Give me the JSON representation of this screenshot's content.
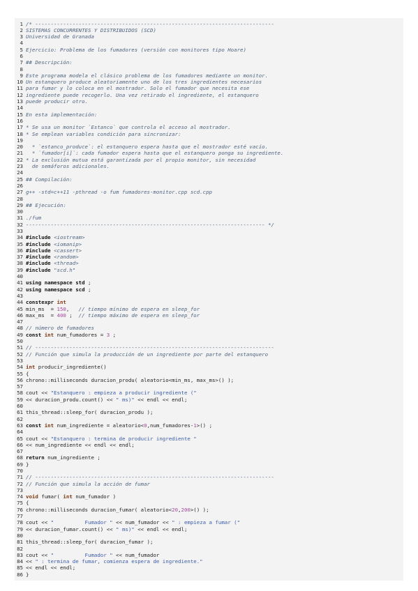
{
  "code": {
    "lines": [
      {
        "n": 1,
        "text": "/* -----------------------------------------------------------------------------"
      },
      {
        "n": 2,
        "text": "SISTEMAS CONCURRENTES Y DISTRIBUIDOS (SCD)"
      },
      {
        "n": 3,
        "text": "Universidad de Granada"
      },
      {
        "n": 4,
        "text": ""
      },
      {
        "n": 5,
        "text": "Ejercicio: Problema de los fumadores (versión con monitores tipo Hoare)"
      },
      {
        "n": 6,
        "text": ""
      },
      {
        "n": 7,
        "text": "## Descripción:"
      },
      {
        "n": 8,
        "text": ""
      },
      {
        "n": 9,
        "text": "Este programa modela el clásico problema de los fumadores mediante un monitor."
      },
      {
        "n": 10,
        "text": "Un estanquero produce aleatoriamente uno de los tres ingredientes necesarios"
      },
      {
        "n": 11,
        "text": "para fumar y lo coloca en el mostrador. Solo el fumador que necesita ese"
      },
      {
        "n": 12,
        "text": "ingrediente puede recogerlo. Una vez retirado el ingrediente, el estanquero"
      },
      {
        "n": 13,
        "text": "puede producir otro."
      },
      {
        "n": 14,
        "text": ""
      },
      {
        "n": 15,
        "text": "En esta implementación:"
      },
      {
        "n": 16,
        "text": ""
      },
      {
        "n": 17,
        "text": "* Se usa un monitor `Estanco` que controla el acceso al mostrador."
      },
      {
        "n": 18,
        "text": "* Se emplean variables condición para sincronizar:"
      },
      {
        "n": 19,
        "text": ""
      },
      {
        "n": 20,
        "text": "  * `estanco_produce`: el estanquero espera hasta que el mostrador esté vacío."
      },
      {
        "n": 21,
        "text": "  * `fumador[i]`: cada fumador espera hasta que el estanquero ponga su ingrediente."
      },
      {
        "n": 22,
        "text": "* La exclusión mutua está garantizada por el propio monitor, sin necesidad"
      },
      {
        "n": 23,
        "text": "  de semáforos adicionales."
      },
      {
        "n": 24,
        "text": ""
      },
      {
        "n": 25,
        "text": "## Compilación:"
      },
      {
        "n": 26,
        "text": ""
      },
      {
        "n": 27,
        "text": "g++ -std=c++11 -pthread -o fum fumadores-monitor.cpp scd.cpp"
      },
      {
        "n": 28,
        "text": ""
      },
      {
        "n": 29,
        "text": "## Ejecución:"
      },
      {
        "n": 30,
        "text": ""
      },
      {
        "n": 31,
        "text": "./fum"
      },
      {
        "n": 32,
        "text": "----------------------------------------------------------------------------- */"
      },
      {
        "n": 33,
        "text": ""
      },
      {
        "n": 34,
        "text": "#include <iostream>"
      },
      {
        "n": 35,
        "text": "#include <iomanip>"
      },
      {
        "n": 36,
        "text": "#include <cassert>"
      },
      {
        "n": 37,
        "text": "#include <random>"
      },
      {
        "n": 38,
        "text": "#include <thread>"
      },
      {
        "n": 39,
        "text": "#include \"scd.h\""
      },
      {
        "n": 40,
        "text": ""
      },
      {
        "n": 41,
        "text": "using namespace std ;"
      },
      {
        "n": 42,
        "text": "using namespace scd ;"
      },
      {
        "n": 43,
        "text": ""
      },
      {
        "n": 44,
        "text": "constexpr int"
      },
      {
        "n": 45,
        "text": "min_ms  = 150,   // tiempo mínimo de espera en sleep_for"
      },
      {
        "n": 46,
        "text": "max_ms  = 400 ;  // tiempo máximo de espera en sleep_for"
      },
      {
        "n": 47,
        "text": ""
      },
      {
        "n": 48,
        "text": "// número de fumadores"
      },
      {
        "n": 49,
        "text": "const int num_fumadores = 3 ;"
      },
      {
        "n": 50,
        "text": ""
      },
      {
        "n": 51,
        "text": "// -----------------------------------------------------------------------------"
      },
      {
        "n": 52,
        "text": "// Función que simula la producción de un ingrediente por parte del estanquero"
      },
      {
        "n": 53,
        "text": ""
      },
      {
        "n": 54,
        "text": "int producir_ingrediente()"
      },
      {
        "n": 55,
        "text": "{"
      },
      {
        "n": 56,
        "text": "chrono::milliseconds duracion_produ( aleatorio<min_ms, max_ms>() );"
      },
      {
        "n": 57,
        "text": ""
      },
      {
        "n": 58,
        "text": "cout << \"Estanquero : empieza a producir ingrediente (\""
      },
      {
        "n": 59,
        "text": "<< duracion_produ.count() << \" ms)\" << endl << endl;"
      },
      {
        "n": 60,
        "text": ""
      },
      {
        "n": 61,
        "text": "this_thread::sleep_for( duracion_produ );"
      },
      {
        "n": 62,
        "text": ""
      },
      {
        "n": 63,
        "text": "const int num_ingrediente = aleatorio<0,num_fumadores-1>() ;"
      },
      {
        "n": 64,
        "text": ""
      },
      {
        "n": 65,
        "text": "cout << \"Estanquero : termina de producir ingrediente \""
      },
      {
        "n": 66,
        "text": "<< num_ingrediente << endl << endl;"
      },
      {
        "n": 67,
        "text": ""
      },
      {
        "n": 68,
        "text": "return num_ingrediente ;"
      },
      {
        "n": 69,
        "text": "}"
      },
      {
        "n": 70,
        "text": ""
      },
      {
        "n": 71,
        "text": "// -----------------------------------------------------------------------------"
      },
      {
        "n": 72,
        "text": "// Función que simula la acción de fumar"
      },
      {
        "n": 73,
        "text": ""
      },
      {
        "n": 74,
        "text": "void fumar( int num_fumador )"
      },
      {
        "n": 75,
        "text": "{"
      },
      {
        "n": 76,
        "text": "chrono::milliseconds duracion_fumar( aleatorio<20,200>() );"
      },
      {
        "n": 77,
        "text": ""
      },
      {
        "n": 78,
        "text": "cout << \"          Fumador \" << num_fumador << \" : empieza a fumar (\""
      },
      {
        "n": 79,
        "text": "<< duracion_fumar.count() << \" ms)\" << endl << endl;"
      },
      {
        "n": 80,
        "text": ""
      },
      {
        "n": 81,
        "text": "this_thread::sleep_for( duracion_fumar );"
      },
      {
        "n": 82,
        "text": ""
      },
      {
        "n": 83,
        "text": "cout << \"          Fumador \" << num_fumador"
      },
      {
        "n": 84,
        "text": "<< \" : termina de fumar, comienza espera de ingrediente.\""
      },
      {
        "n": 85,
        "text": "<< endl << endl;"
      },
      {
        "n": 86,
        "text": "}"
      }
    ]
  }
}
